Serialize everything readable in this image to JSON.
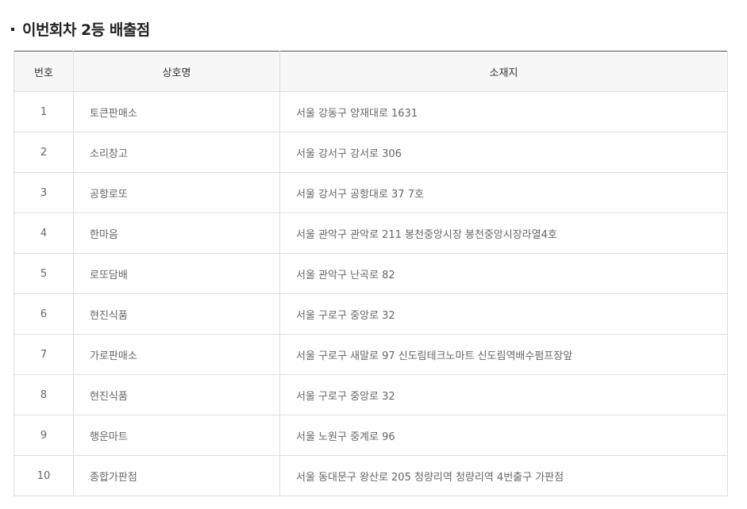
{
  "section": {
    "title": "이번회차 2등 배출점"
  },
  "table": {
    "headers": {
      "no": "번호",
      "name": "상호명",
      "address": "소재지"
    },
    "rows": [
      {
        "no": "1",
        "name": "토큰판매소",
        "address": "서울 강동구 양재대로 1631"
      },
      {
        "no": "2",
        "name": "소리창고",
        "address": "서울 강서구 강서로 306"
      },
      {
        "no": "3",
        "name": "공항로또",
        "address": "서울 강서구 공항대로 37 7호"
      },
      {
        "no": "4",
        "name": "한마음",
        "address": "서울 관악구 관악로 211 봉천중앙시장 봉천중앙시장라열4호"
      },
      {
        "no": "5",
        "name": "로또담배",
        "address": "서울 관악구 난곡로 82"
      },
      {
        "no": "6",
        "name": "현진식품",
        "address": "서울 구로구 중앙로 32"
      },
      {
        "no": "7",
        "name": "가로판매소",
        "address": "서울 구로구 새말로 97 신도림테크노마트 신도림역배수펌프장앞"
      },
      {
        "no": "8",
        "name": "현진식품",
        "address": "서울 구로구 중앙로 32"
      },
      {
        "no": "9",
        "name": "행운마트",
        "address": "서울 노원구 중계로 96"
      },
      {
        "no": "10",
        "name": "종합가판점",
        "address": "서울 동대문구 왕산로 205 청량리역 청량리역 4번출구 가판점"
      }
    ]
  }
}
